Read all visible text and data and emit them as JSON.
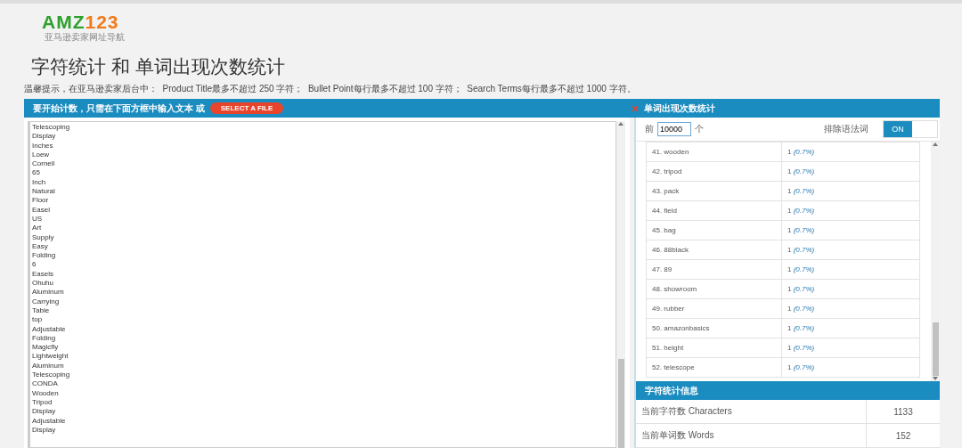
{
  "logo": {
    "brand": "AMZ",
    "number": "123",
    "tagline": "亚马逊卖家网址导航"
  },
  "title": "字符统计 和 单词出现次数统计",
  "hint": "温馨提示，在亚马逊卖家后台中：  Product Title最多不超过 250 字符；  Bullet Point每行最多不超过 100 字符；  Search Terms每行最多不超过 1000 字符。",
  "input_panel": {
    "header": "要开始计数，只需在下面方框中输入文本 或",
    "button": "SELECT A FILE",
    "text": [
      "Telescoping",
      "Display",
      "Inches",
      "Loew",
      "Cornell",
      "65",
      "Inch",
      "Natural",
      "Floor",
      "Easel",
      "US",
      "Art",
      "Supply",
      "Easy",
      "Folding",
      "6",
      "Easels",
      "Ohuhu",
      "Aluminum",
      "Carrying",
      "Table",
      "top",
      "Adjustable",
      "Folding",
      "Magicfly",
      "Lightweight",
      "Aluminum",
      "Telescoping",
      "CONDA",
      "Wooden",
      "Tripod",
      "Display",
      "Adjustable",
      "Display"
    ]
  },
  "word_panel": {
    "title": "单词出现次数统计",
    "top_prefix": "前",
    "top_value": "10000",
    "top_suffix": "个",
    "exclude_label": "排除语法词",
    "exclude_on": true,
    "toggle_label": "ON",
    "rows": [
      {
        "word": "41. wooden",
        "count": "1",
        "percent": "(0.7%)"
      },
      {
        "word": "42. tripod",
        "count": "1",
        "percent": "(0.7%)"
      },
      {
        "word": "43. pack",
        "count": "1",
        "percent": "(0.7%)"
      },
      {
        "word": "44. field",
        "count": "1",
        "percent": "(0.7%)"
      },
      {
        "word": "45. bag",
        "count": "1",
        "percent": "(0.7%)"
      },
      {
        "word": "46. 88black",
        "count": "1",
        "percent": "(0.7%)"
      },
      {
        "word": "47. 89",
        "count": "1",
        "percent": "(0.7%)"
      },
      {
        "word": "48. showroom",
        "count": "1",
        "percent": "(0.7%)"
      },
      {
        "word": "49. rubber",
        "count": "1",
        "percent": "(0.7%)"
      },
      {
        "word": "50. amazonbasics",
        "count": "1",
        "percent": "(0.7%)"
      },
      {
        "word": "51. height",
        "count": "1",
        "percent": "(0.7%)"
      },
      {
        "word": "52. telescope",
        "count": "1",
        "percent": "(0.7%)"
      }
    ]
  },
  "stats": {
    "title": "字符统计信息",
    "rows": [
      {
        "label": "当前字符数 Characters",
        "value": "1133"
      },
      {
        "label": "当前单词数 Words",
        "value": "152"
      }
    ]
  }
}
